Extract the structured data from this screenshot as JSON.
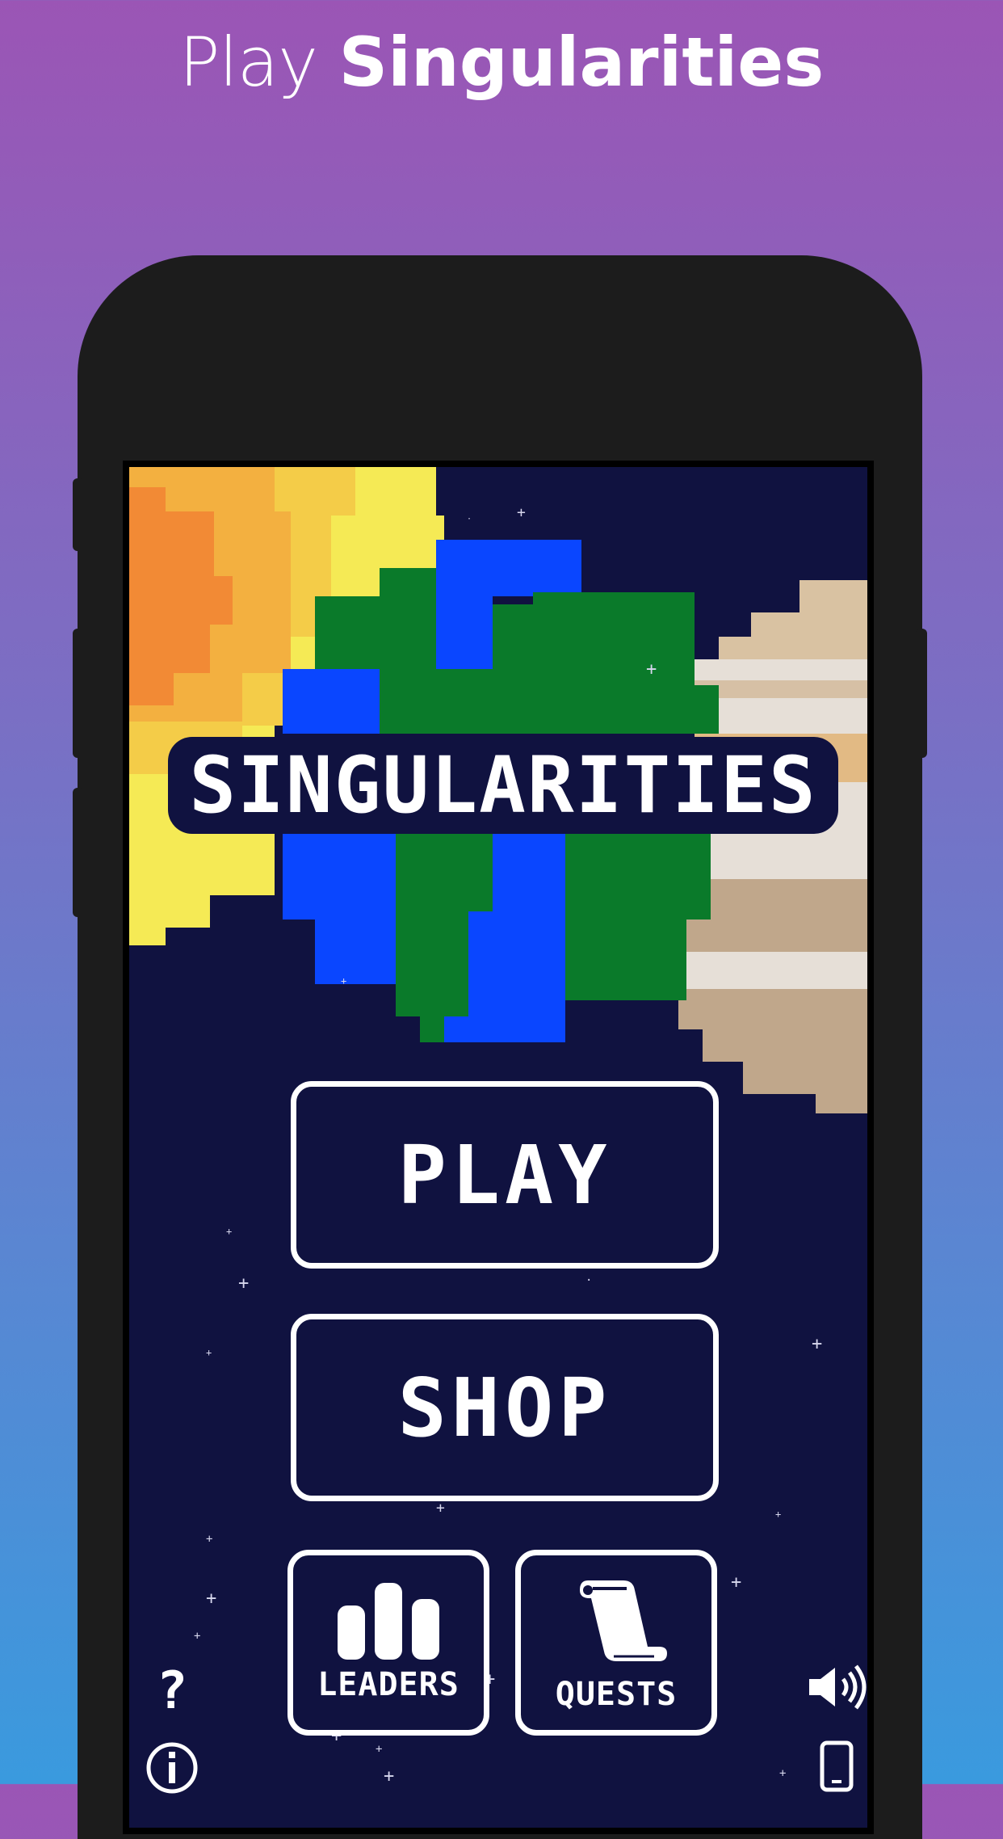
{
  "header": {
    "title_light": "Play",
    "title_bold": "Singularities"
  },
  "game": {
    "logo_text": "SINGULARITIES",
    "buttons": {
      "play": "PLAY",
      "shop": "SHOP",
      "leaders": "LEADERS",
      "quests": "QUESTS"
    },
    "corner_icons": {
      "help": "?",
      "info": "info-icon",
      "sound": "speaker-icon",
      "device": "phone-icon"
    }
  },
  "colors": {
    "background_top": "#9b55b5",
    "background_bottom": "#3a9ade",
    "space": "#101240",
    "earth_ocean": "#0a46ff",
    "earth_land": "#0a7a2a",
    "sun_outer": "#f5ea55",
    "sun_inner": "#f28a35",
    "gas_giant": "#d9c2a2"
  }
}
